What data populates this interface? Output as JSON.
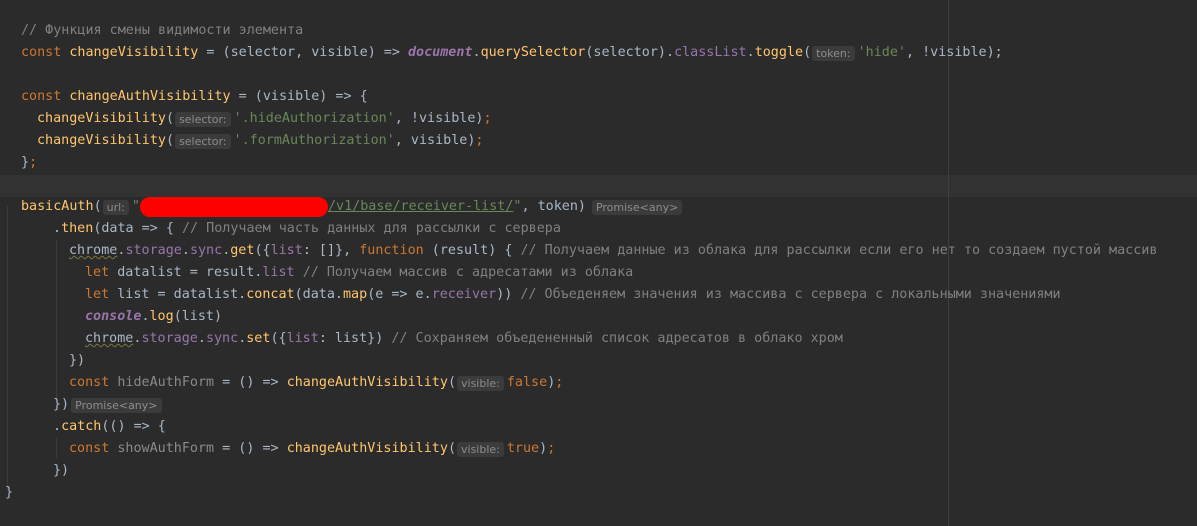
{
  "editor": {
    "lines": {
      "l1": {
        "comment": "// Функция смены видимости элемента"
      },
      "l2": {
        "kw_const": "const",
        "name": "changeVisibility",
        "eq": " = (",
        "p1": "selector",
        "comma1": ", ",
        "p2": "visible",
        "arrow": ") => ",
        "doc": "document",
        "dot1": ".",
        "qs": "querySelector",
        "args1": "(selector).",
        "classList": "classList",
        "dot2": ".",
        "toggle": "toggle",
        "paren_open": "(",
        "hint": "token:",
        "str_hide": "'hide'",
        "tail_a": ", !vi",
        "tail_b": "sible",
        "tail_c": ");"
      },
      "l4": {
        "kw_const": "const",
        "name": "changeAuthVisibility",
        "rest": " = (visible) => {"
      },
      "l5": {
        "call": "changeVisibility",
        "paren_open": "(",
        "hint": "selector:",
        "str": "'.hideAuthorization'",
        "rest": ", !visible)",
        "semi": ";"
      },
      "l6": {
        "call": "changeVisibility",
        "paren_open": "(",
        "hint": "selector:",
        "str": "'.formAuthorization'",
        "rest": ", visible)",
        "semi": ";"
      },
      "l7": {
        "text": "}",
        "semi": ";"
      },
      "l9": {
        "call": "basicAuth",
        "paren_open": "(",
        "hint": "url:",
        "str_open": "\"",
        "str_path": "/v1/base/receiver-list/",
        "str_close": "\"",
        "rest": ", token)",
        "hint_after": "Promise<any>"
      },
      "l10": {
        "dot": ".",
        "then": "then",
        "rest": "(data => { ",
        "comment": "// Получаем часть данных для рассылки с сервера"
      },
      "l11": {
        "chrome": "chrome",
        "dot1": ".",
        "storage": "storage",
        "dot2": ".",
        "sync": "sync",
        "dot3": ".",
        "get": "get",
        "paren": "({",
        "list": "list",
        "colon": ": []}, ",
        "kw_function": "function",
        "args": " (result) { ",
        "comment": "// Получаем данные из облака для рассылки если его нет то создаем пустой массив"
      },
      "l12": {
        "kw_let": "let",
        "decl": " datalist = result.",
        "list": "list",
        "space": " ",
        "comment": "// Получаем массив с адресатами из облака"
      },
      "l13": {
        "kw_let": "let",
        "decl": " list = datalist.",
        "concat": "concat",
        "p1": "(data.",
        "map": "map",
        "p2": "(e => e.",
        "receiver": "receiver",
        "p3": ")) ",
        "comment": "// Объеденяем значения из массива с сервера с локальными значениями"
      },
      "l14": {
        "console": "console",
        "dot": ".",
        "log": "log",
        "args": "(list)"
      },
      "l15": {
        "chrome": "chrome",
        "dot1": ".",
        "storage": "storage",
        "dot2": ".",
        "sync": "sync",
        "dot3": ".",
        "set": "set",
        "paren": "({",
        "list": "list",
        "args": ": list}) ",
        "comment": "// Сохраняем объедененный список адресатов в облако хром"
      },
      "l16": {
        "text": "})"
      },
      "l17": {
        "kw_const": "const",
        "name": " hideAuthForm",
        "mid": " = () => ",
        "call": "changeAuthVisibility",
        "paren_open": "(",
        "hint": "visible:",
        "val": "false",
        "close": ")",
        "semi": ";"
      },
      "l18": {
        "text": "})",
        "hint_after": "Promise<any>"
      },
      "l19": {
        "dot": ".",
        "catch": "catch",
        "rest": "(() => {"
      },
      "l20": {
        "kw_const": "const",
        "name": " showAuthForm",
        "mid": " = () => ",
        "call": "changeAuthVisibility",
        "paren_open": "(",
        "hint": "visible:",
        "val": "true",
        "close": ")",
        "semi": ";"
      },
      "l21": {
        "text": "})"
      },
      "l22": {
        "text": "}"
      }
    }
  }
}
